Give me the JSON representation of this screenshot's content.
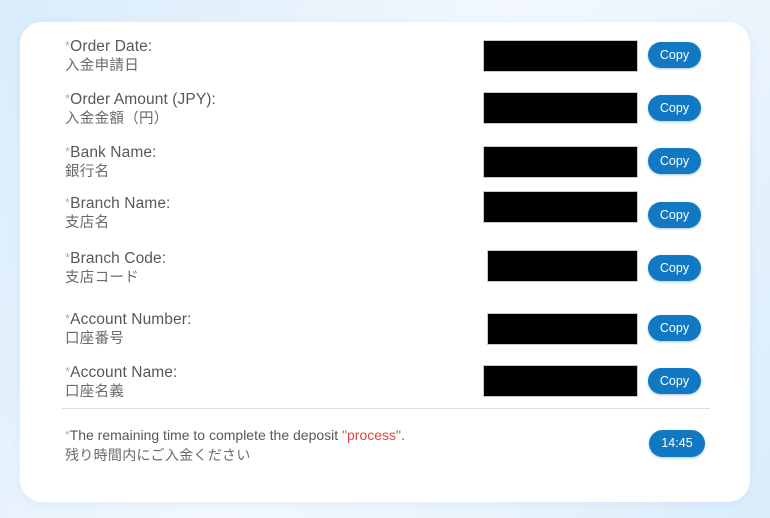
{
  "form": {
    "fields": [
      {
        "id": "order-date",
        "label_en": "Order Date:",
        "label_ja": "入金申請日",
        "required_marker": "*",
        "value": "",
        "value_redacted": true,
        "copy_label": "Copy"
      },
      {
        "id": "order-amount",
        "label_en": "Order Amount (JPY):",
        "label_ja": "入金金額（円）",
        "required_marker": "*",
        "value": "",
        "value_redacted": true,
        "copy_label": "Copy"
      },
      {
        "id": "bank-name",
        "label_en": "Bank Name:",
        "label_ja": "銀行名",
        "required_marker": "*",
        "value": "",
        "value_redacted": true,
        "copy_label": "Copy"
      },
      {
        "id": "branch-name",
        "label_en": "Branch Name:",
        "label_ja": "支店名",
        "required_marker": "*",
        "value": "",
        "value_redacted": true,
        "copy_label": "Copy"
      },
      {
        "id": "branch-code",
        "label_en": "Branch Code:",
        "label_ja": "支店コード",
        "required_marker": "*",
        "value": "",
        "value_redacted": true,
        "copy_label": "Copy"
      },
      {
        "id": "account-number",
        "label_en": "Account Number:",
        "label_ja": "口座番号",
        "required_marker": "*",
        "value": "",
        "value_redacted": true,
        "copy_label": "Copy"
      },
      {
        "id": "account-name",
        "label_en": "Account Name:",
        "label_ja": "口座名義",
        "required_marker": "*",
        "value": "",
        "value_redacted": true,
        "copy_label": "Copy"
      }
    ]
  },
  "footer": {
    "required_marker": "*",
    "note_en_before": "The remaining time to complete the deposit ",
    "note_en_highlight": "\"process\"",
    "note_en_after": ".",
    "note_ja": "残り時間内にご入金ください",
    "timer": "14:45"
  },
  "colors": {
    "accent_blue": "#1179c4",
    "highlight_red": "#e8443a",
    "required_star": "#8fb8d8",
    "label_text": "#58585a",
    "card_background": "#ffffff",
    "page_background": "#dceefb",
    "redaction": "#000000"
  }
}
